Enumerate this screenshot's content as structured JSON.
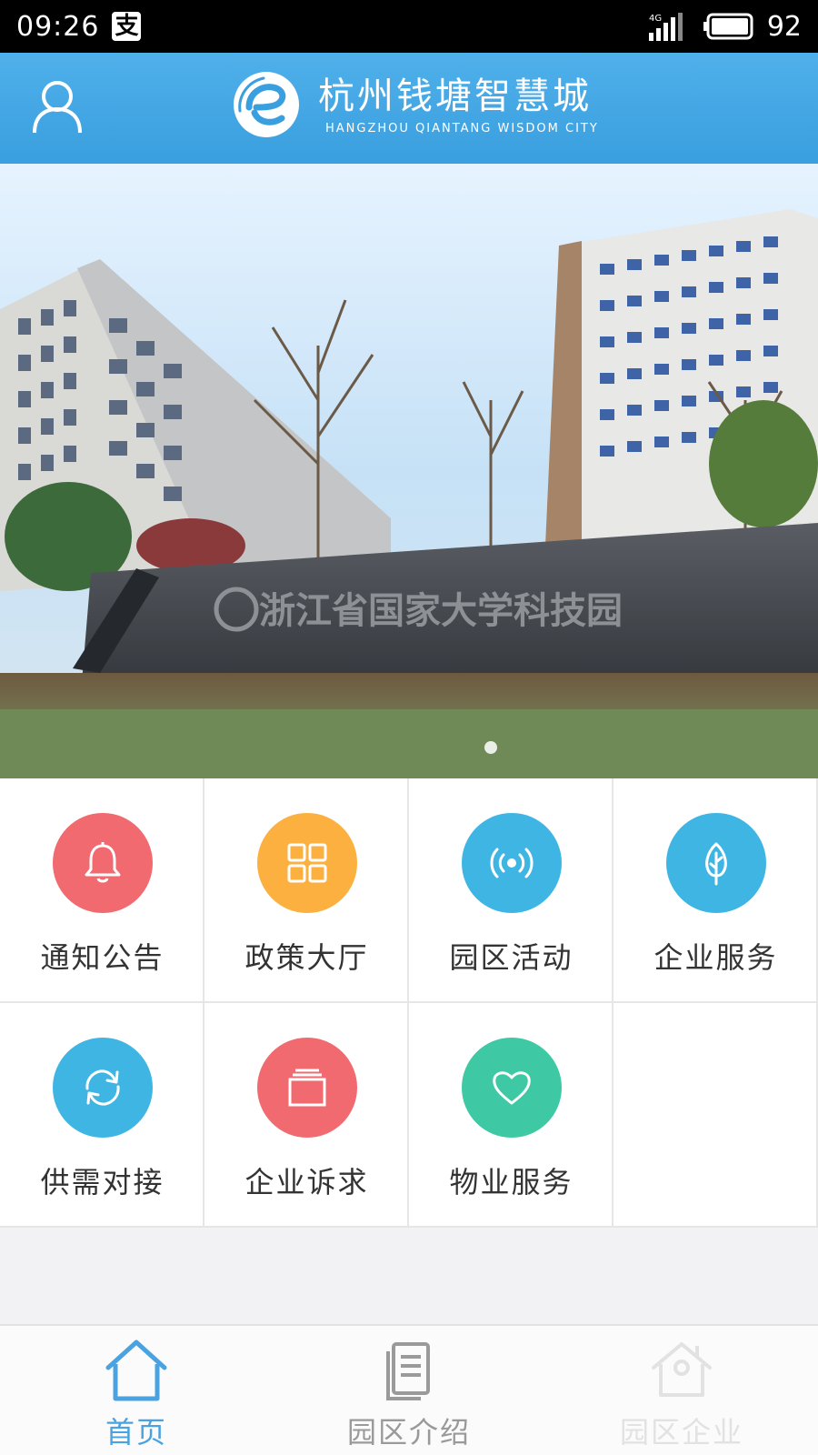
{
  "status_bar": {
    "time": "09:26",
    "notification_app": "支",
    "network": "4G",
    "battery": "92"
  },
  "header": {
    "title_cn": "杭州钱塘智慧城",
    "title_en": "HANGZHOU  QIANTANG  WISDOM CITY",
    "brand_color": "#45a9e6"
  },
  "banner": {
    "sign_text_cn": "浙江省国家大学科技园",
    "active_slide": 1,
    "slide_count": 1
  },
  "menu": {
    "items": [
      {
        "label": "通知公告",
        "icon": "bell-icon",
        "color": "#f06a6f"
      },
      {
        "label": "政策大厅",
        "icon": "grid-icon",
        "color": "#fbb040"
      },
      {
        "label": "园区活动",
        "icon": "broadcast-icon",
        "color": "#3fb5e4"
      },
      {
        "label": "企业服务",
        "icon": "leaf-icon",
        "color": "#3fb5e4"
      },
      {
        "label": "供需对接",
        "icon": "refresh-icon",
        "color": "#3fb5e4"
      },
      {
        "label": "企业诉求",
        "icon": "folder-icon",
        "color": "#f06a6f"
      },
      {
        "label": "物业服务",
        "icon": "heart-icon",
        "color": "#3ec9a4"
      }
    ]
  },
  "tab_bar": {
    "tabs": [
      {
        "label": "首页",
        "icon": "home-icon",
        "active": true,
        "color": "#4aa3e0"
      },
      {
        "label": "园区介绍",
        "icon": "document-icon",
        "active": false,
        "color": "#9a9a9a"
      },
      {
        "label": "园区企业",
        "icon": "house-enterprise-icon",
        "active": false,
        "color": "#e2e2e2"
      }
    ]
  }
}
